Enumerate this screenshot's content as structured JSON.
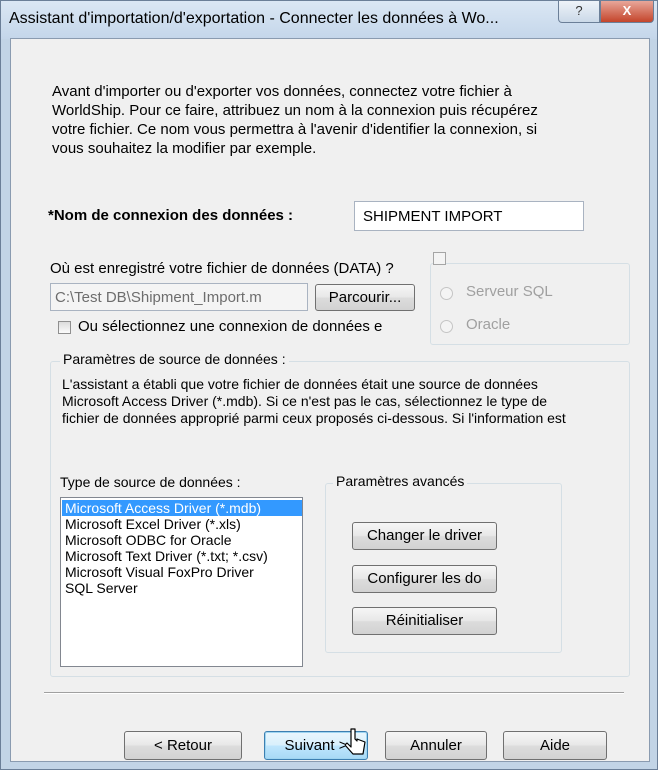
{
  "window": {
    "title": "Assistant d'importation/d'exportation - Connecter les données à Wo...",
    "help_glyph": "?",
    "close_glyph": "X"
  },
  "intro_text": "Avant d'importer ou d'exporter vos données, connectez votre fichier à WorldShip. Pour ce faire, attribuez un nom à la connexion puis récupérez votre fichier. Ce nom vous permettra à l'avenir d'identifier la connexion, si vous souhaitez la modifier par exemple.",
  "connection_name": {
    "label": "*Nom de connexion des données :",
    "value": "SHIPMENT IMPORT"
  },
  "data_file": {
    "label": "Où est enregistré votre fichier de données (DATA) ?",
    "path_value": "C:\\Test DB\\Shipment_Import.m",
    "browse_label": "Parcourir..."
  },
  "existing_connection": {
    "label": "Ou sélectionnez une connexion de données e",
    "checked": false
  },
  "server_options": {
    "sql_label": "Serveur SQL",
    "oracle_label": "Oracle",
    "enabled": false
  },
  "source_params": {
    "title": "Paramètres de source de données :",
    "description": "L'assistant a établi que votre fichier de données était une source de données Microsoft Access Driver (*.mdb). Si ce n'est pas le cas, sélectionnez le type de fichier de données approprié parmi ceux proposés ci-dessous. Si l'information est correcte, cliquez sur le bouton \" Suivant \"."
  },
  "data_source_type": {
    "label": "Type de source de données :",
    "items": [
      "Microsoft Access Driver (*.mdb)",
      "Microsoft Excel Driver (*.xls)",
      "Microsoft ODBC for Oracle",
      "Microsoft Text Driver (*.txt; *.csv)",
      "Microsoft Visual FoxPro Driver",
      "SQL Server"
    ],
    "selected_index": 0
  },
  "advanced": {
    "title": "Paramètres avancés",
    "change_driver": "Changer le driver",
    "configure": "Configurer les do",
    "reset": "Réinitialiser"
  },
  "footer": {
    "back": "< Retour",
    "next": "Suivant >",
    "cancel": "Annuler",
    "help": "Aide"
  },
  "colors": {
    "selection": "#3399ff",
    "close_button": "#c4452b",
    "titlebar": "#c4d6ea"
  }
}
